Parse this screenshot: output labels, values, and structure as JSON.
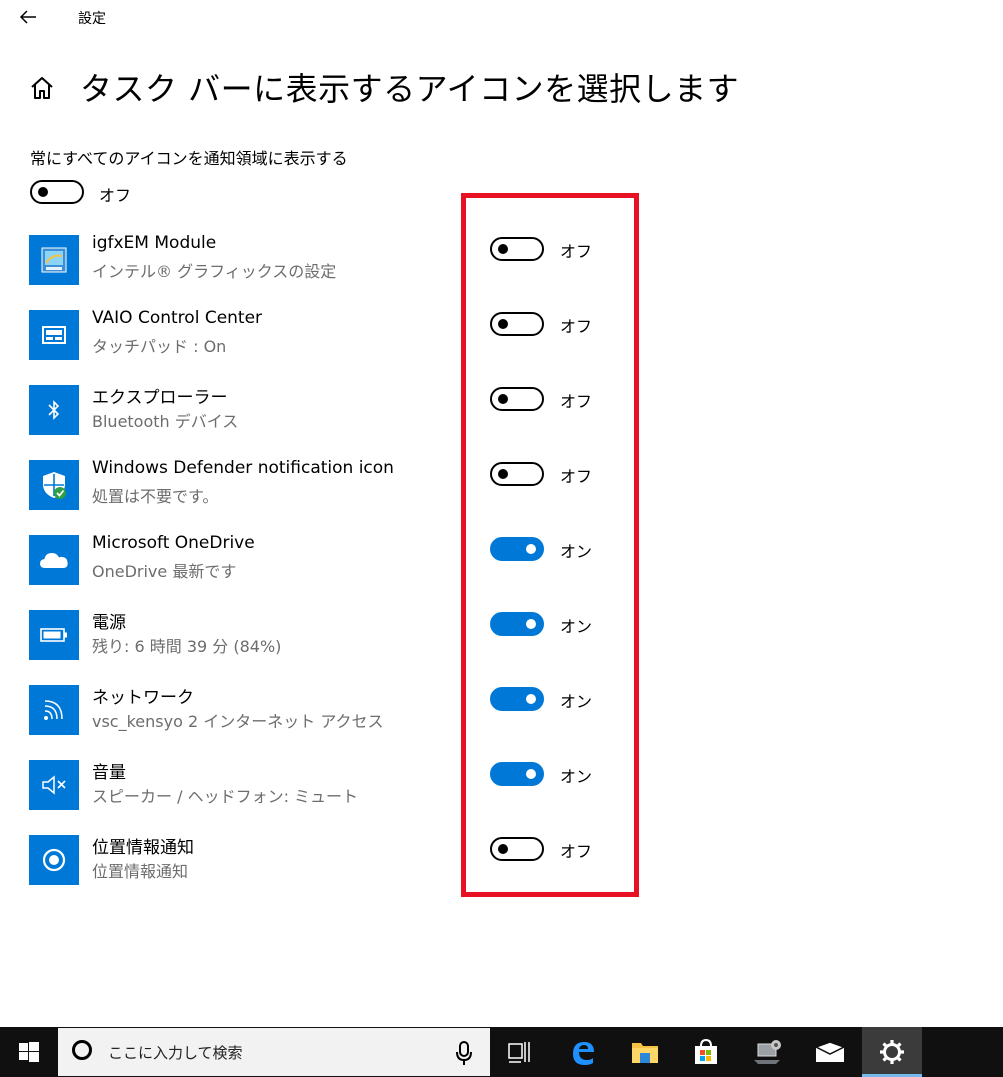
{
  "window": {
    "title": "設定"
  },
  "header": {
    "title": "タスク バーに表示するアイコンを選択します"
  },
  "master": {
    "label": "常にすべてのアイコンを通知領域に表示する",
    "state_label": "オフ",
    "on": false
  },
  "items": [
    {
      "name": "igfxEM Module",
      "sub": "インテル® グラフィックスの設定",
      "state_label": "オフ",
      "on": false,
      "icon": "intel-graphics-icon"
    },
    {
      "name": "VAIO Control Center",
      "sub": "タッチパッド : On",
      "state_label": "オフ",
      "on": false,
      "icon": "touchpad-icon"
    },
    {
      "name": "エクスプローラー",
      "sub": "Bluetooth デバイス",
      "state_label": "オフ",
      "on": false,
      "icon": "bluetooth-icon"
    },
    {
      "name": "Windows Defender notification icon",
      "sub": "処置は不要です。",
      "state_label": "オフ",
      "on": false,
      "icon": "defender-shield-icon"
    },
    {
      "name": "Microsoft OneDrive",
      "sub": "OneDrive 最新です",
      "state_label": "オン",
      "on": true,
      "icon": "onedrive-cloud-icon"
    },
    {
      "name": "電源",
      "sub": "残り: 6 時間 39 分 (84%)",
      "state_label": "オン",
      "on": true,
      "icon": "battery-icon"
    },
    {
      "name": "ネットワーク",
      "sub": "vsc_kensyo 2 インターネット アクセス",
      "state_label": "オン",
      "on": true,
      "icon": "wifi-icon"
    },
    {
      "name": "音量",
      "sub": "スピーカー / ヘッドフォン: ミュート",
      "state_label": "オン",
      "on": true,
      "icon": "volume-muted-icon"
    },
    {
      "name": "位置情報通知",
      "sub": "位置情報通知",
      "state_label": "オフ",
      "on": false,
      "icon": "location-icon"
    }
  ],
  "taskbar": {
    "search_placeholder": "ここに入力して検索",
    "buttons": [
      "task-view-icon",
      "edge-icon",
      "file-explorer-icon",
      "store-icon",
      "network-settings-icon",
      "mail-icon",
      "settings-gear-icon"
    ]
  },
  "colors": {
    "accent": "#0078d7",
    "highlight": "#e81123",
    "taskbar": "#101010"
  }
}
